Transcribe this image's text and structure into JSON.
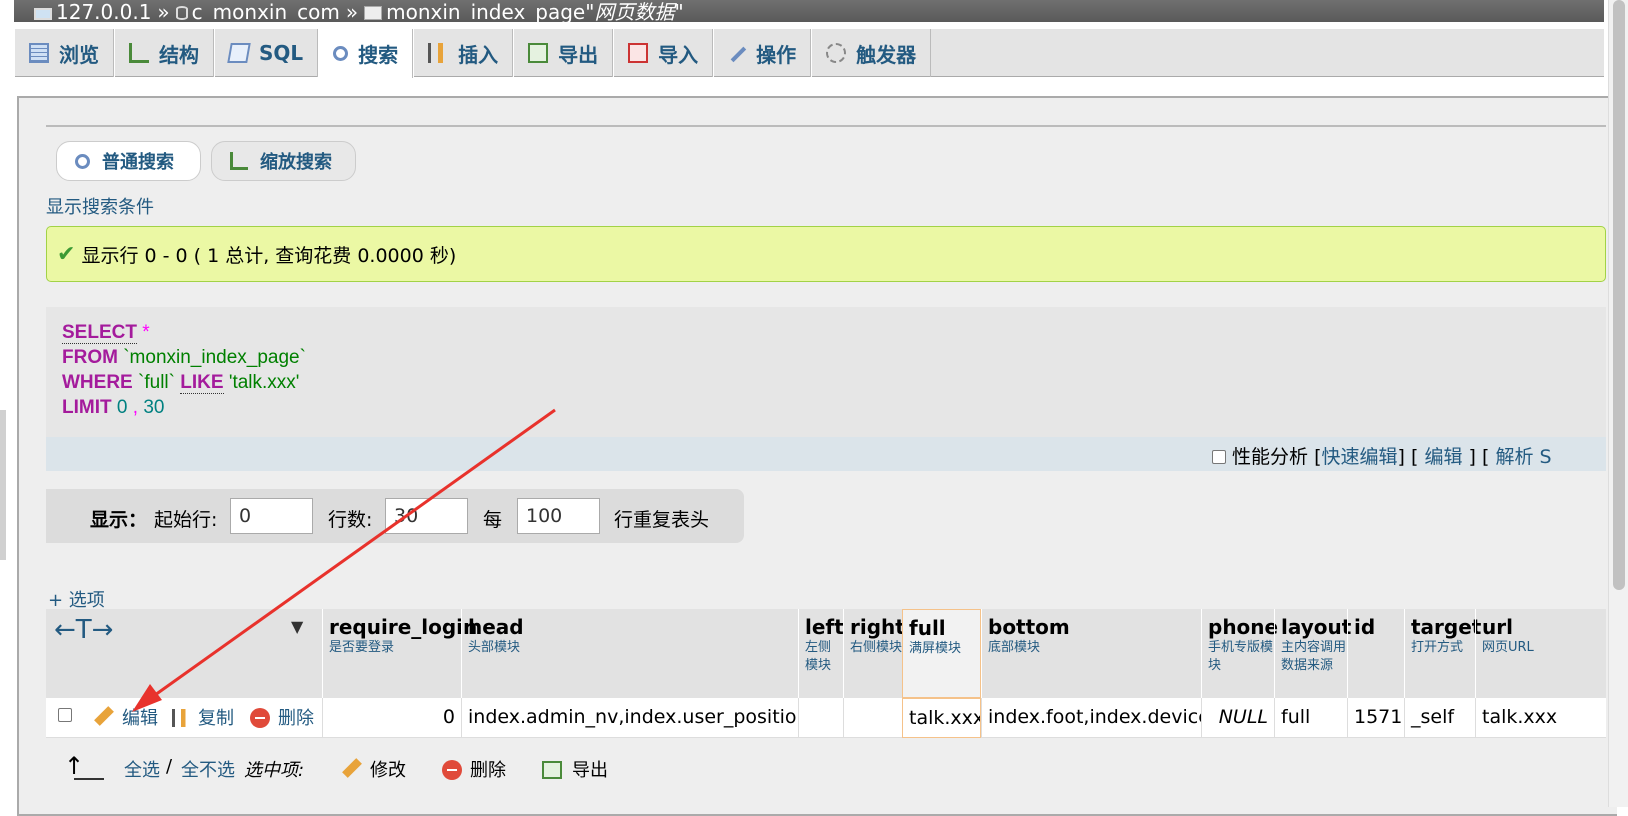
{
  "breadcrumb": {
    "server": "127.0.0.1",
    "sep1": "»",
    "database": "c_monxin_com",
    "sep2": "»",
    "table": "monxin_index_page",
    "table_comment": "\"网页数据\""
  },
  "tabs": [
    {
      "label": "浏览",
      "icon": "browse-icon"
    },
    {
      "label": "结构",
      "icon": "structure-icon"
    },
    {
      "label": "SQL",
      "icon": "sql-icon"
    },
    {
      "label": "搜索",
      "icon": "search-icon",
      "active": true
    },
    {
      "label": "插入",
      "icon": "insert-icon"
    },
    {
      "label": "导出",
      "icon": "export-icon"
    },
    {
      "label": "导入",
      "icon": "import-icon"
    },
    {
      "label": "操作",
      "icon": "wrench-icon"
    },
    {
      "label": "触发器",
      "icon": "trigger-icon"
    }
  ],
  "subtabs": {
    "normal": "普通搜索",
    "zoom": "缩放搜索"
  },
  "show_criteria": "显示搜索条件",
  "message": {
    "text": "显示行 0 - 0 ( 1 总计, 查询花费 0.0000 秒)"
  },
  "sql": {
    "select": "SELECT",
    "star": "*",
    "from": "FROM",
    "table": "`monxin_index_page`",
    "where": "WHERE",
    "column": "`full`",
    "like": "LIKE",
    "value": "'talk.xxx'",
    "limit": "LIMIT",
    "limit_start": "0",
    "comma": ",",
    "limit_count": "30"
  },
  "sql_footer": {
    "profiling": "性能分析",
    "open1": "[",
    "inline_edit": "快速编辑",
    "close1": "]",
    "open2": "[",
    "edit": "编辑",
    "close2": "]",
    "open3": "[",
    "explain": "解析 S"
  },
  "display": {
    "label": "显示：",
    "start_label": "起始行:",
    "start_value": "0",
    "rows_label": "行数:",
    "rows_value": "30",
    "per_label": "每",
    "per_value": "100",
    "repeat_label": "行重复表头"
  },
  "options_link": "+ 选项",
  "table": {
    "sort_arrows": "←T→",
    "columns": [
      {
        "name": "require_login",
        "comment": "是否要登录"
      },
      {
        "name": "head",
        "comment": "头部模块"
      },
      {
        "name": "left",
        "comment": "左侧模块"
      },
      {
        "name": "right",
        "comment": "右侧模块"
      },
      {
        "name": "full",
        "comment": "满屏模块"
      },
      {
        "name": "bottom",
        "comment": "底部模块"
      },
      {
        "name": "phone",
        "comment": "手机专版模块"
      },
      {
        "name": "layout",
        "comment": "主内容调用数据来源"
      },
      {
        "name": "id",
        "comment": ""
      },
      {
        "name": "target",
        "comment": "打开方式"
      },
      {
        "name": "url",
        "comment": "网页URL"
      }
    ],
    "row_actions": {
      "edit": "编辑",
      "copy": "复制",
      "delete": "删除"
    },
    "row": {
      "require_login": "0",
      "head": "index.admin_nv,index.user_position,",
      "left": "",
      "right": "",
      "full": "talk.xxx",
      "bottom": "index.foot,index.device",
      "phone": "NULL",
      "layout": "full",
      "id": "1571",
      "target": "_self",
      "url": "talk.xxx"
    }
  },
  "bottom_actions": {
    "select_all": "全选",
    "slash": "/",
    "deselect_all": "全不选",
    "with_selected": "选中项:",
    "modify": "修改",
    "delete": "删除",
    "export": "导出"
  },
  "colors": {
    "link": "#235a81",
    "success_bg": "#ebf8a4",
    "annotation_arrow": "#e8322c"
  }
}
